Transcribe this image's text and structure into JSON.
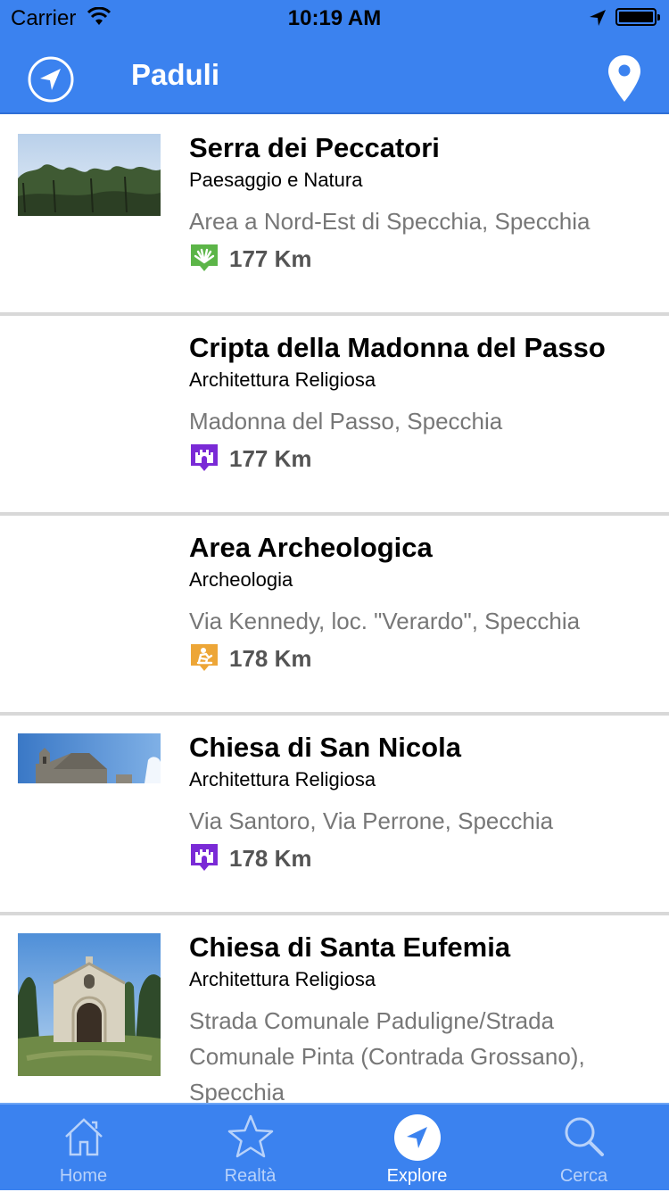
{
  "status_bar": {
    "carrier": "Carrier",
    "time": "10:19 AM"
  },
  "nav": {
    "title": "Paduli",
    "left_icon": "location-arrow-icon",
    "right_icon": "map-pin-icon"
  },
  "colors": {
    "bar_blue": "#3b82ef",
    "nature_green": "#5cb548",
    "religious_purple": "#7a2ad6",
    "archeology_orange": "#eda637"
  },
  "items": [
    {
      "title": "Serra dei Peccatori",
      "category": "Paesaggio e Natura",
      "address": "Area a Nord-Est di Specchia, Specchia",
      "distance": "177 Km",
      "category_icon": "nature-icon",
      "thumbnail": "trees-photo"
    },
    {
      "title": "Cripta della Madonna del Passo",
      "category": "Architettura Religiosa",
      "address": "Madonna del Passo, Specchia",
      "distance": "177 Km",
      "category_icon": "church-icon",
      "thumbnail": ""
    },
    {
      "title": "Area Archeologica",
      "category": "Archeologia",
      "address": "Via Kennedy, loc. \"Verardo\", Specchia",
      "distance": "178 Km",
      "category_icon": "archeology-icon",
      "thumbnail": ""
    },
    {
      "title": "Chiesa di San Nicola",
      "category": "Architettura Religiosa",
      "address": "Via Santoro, Via Perrone, Specchia",
      "distance": "178 Km",
      "category_icon": "church-icon",
      "thumbnail": "church-photo"
    },
    {
      "title": "Chiesa di Santa Eufemia",
      "category": "Architettura Religiosa",
      "address": "Strada Comunale Paduligne/Strada Comunale Pinta (Contrada Grossano), Specchia",
      "distance": "",
      "category_icon": "church-icon",
      "thumbnail": "chapel-photo"
    }
  ],
  "tabs": [
    {
      "label": "Home",
      "icon": "home-icon",
      "active": false
    },
    {
      "label": "Realtà",
      "icon": "star-icon",
      "active": false
    },
    {
      "label": "Explore",
      "icon": "location-arrow-icon",
      "active": true
    },
    {
      "label": "Cerca",
      "icon": "search-icon",
      "active": false
    }
  ]
}
